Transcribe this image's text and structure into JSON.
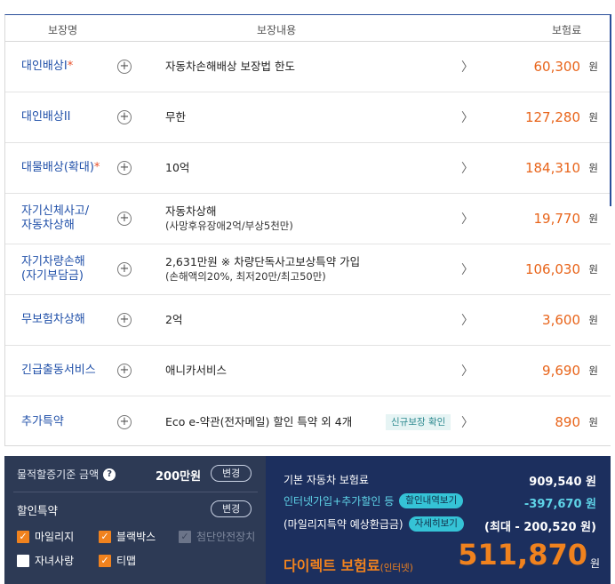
{
  "table": {
    "headers": {
      "name": "보장명",
      "content": "보장내용",
      "premium": "보험료"
    },
    "rows": [
      {
        "name": "대인배상I",
        "star": "*",
        "desc": "자동차손해배상 보장법 한도",
        "sub": "",
        "badge": "",
        "price": "60,300",
        "won": "원"
      },
      {
        "name": "대인배상II",
        "star": "",
        "desc": "무한",
        "sub": "",
        "badge": "",
        "price": "127,280",
        "won": "원"
      },
      {
        "name": "대물배상(확대)",
        "star": "*",
        "desc": "10억",
        "sub": "",
        "badge": "",
        "price": "184,310",
        "won": "원"
      },
      {
        "name": "자기신체사고/\n자동차상해",
        "star": "",
        "desc": "자동차상해",
        "sub": "(사망후유장애2억/부상5천만)",
        "badge": "",
        "price": "19,770",
        "won": "원"
      },
      {
        "name": "자기차량손해\n(자기부담금)",
        "star": "",
        "desc": "2,631만원 ※ 차량단독사고보상특약 가입",
        "sub": "(손해액의20%, 최저20만/최고50만)",
        "badge": "",
        "price": "106,030",
        "won": "원"
      },
      {
        "name": "무보험차상해",
        "star": "",
        "desc": "2억",
        "sub": "",
        "badge": "",
        "price": "3,600",
        "won": "원"
      },
      {
        "name": "긴급출동서비스",
        "star": "",
        "desc": "애니카서비스",
        "sub": "",
        "badge": "",
        "price": "9,690",
        "won": "원"
      },
      {
        "name": "추가특약",
        "star": "",
        "desc": "Eco e-약관(전자메일) 할인 특약 외 4개",
        "sub": "",
        "badge": "신규보장 확인",
        "price": "890",
        "won": "원"
      }
    ]
  },
  "left_panel": {
    "threshold_label": "물적할증기준 금액",
    "threshold_value": "200만원",
    "change_label": "변경",
    "discount_title": "할인특약",
    "discount_change_label": "변경",
    "options": [
      {
        "label": "마일리지",
        "state": "checked"
      },
      {
        "label": "블랙박스",
        "state": "checked"
      },
      {
        "label": "첨단안전장치",
        "state": "disabled"
      },
      {
        "label": "자녀사랑",
        "state": "unchecked"
      },
      {
        "label": "티맵",
        "state": "checked"
      }
    ]
  },
  "right_panel": {
    "base_label": "기본 자동차 보험료",
    "base_value": "909,540 원",
    "discount_label": "인터넷가입+추가할인 등",
    "discount_btn": "할인내역보기",
    "discount_value": "-397,670 원",
    "mileage_label": "(마일리지특약 예상환급금)",
    "mileage_btn": "자세히보기",
    "mileage_value": "(최대 - 200,520 원)",
    "total_label": "다이렉트 보험료",
    "total_suffix": "(인터넷)",
    "total_value": "511,870",
    "total_won": "원"
  },
  "colors": {
    "accent_blue": "#1f4fa8",
    "price_orange": "#e8641a",
    "panel_dark": "#2d3a55",
    "panel_navy": "#1c2f5e",
    "cyan": "#5fd4e8"
  },
  "icons": {
    "expand": "plus-circle-icon",
    "row_nav": "chevron-right-icon",
    "help": "question-circle-icon"
  }
}
